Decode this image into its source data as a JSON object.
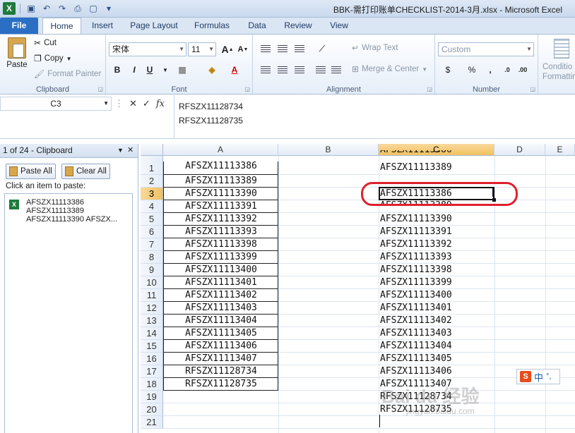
{
  "window": {
    "title": "BBK-需打印账单CHECKLIST-2014-3月.xlsx - Microsoft Excel"
  },
  "tabs": [
    "File",
    "Home",
    "Insert",
    "Page Layout",
    "Formulas",
    "Data",
    "Review",
    "View"
  ],
  "active_tab": "Home",
  "ribbon": {
    "clipboard": {
      "label": "Clipboard",
      "paste": "Paste",
      "cut": "Cut",
      "copy": "Copy",
      "format_painter": "Format Painter"
    },
    "font": {
      "label": "Font",
      "font_name": "宋体",
      "font_size": "11",
      "bold": "B",
      "italic": "I",
      "underline": "U",
      "grow": "A",
      "shrink": "A"
    },
    "alignment": {
      "label": "Alignment",
      "wrap_text": "Wrap Text",
      "merge_center": "Merge & Center"
    },
    "number": {
      "label": "Number",
      "format": "Custom",
      "currency": "$",
      "percent": "%",
      "comma": ","
    },
    "styles": {
      "conditional": "Conditio",
      "formatting": "Formattin"
    }
  },
  "formula_bar": {
    "name_box": "C3",
    "cancel": "✕",
    "enter": "✓",
    "fx": "fx",
    "content_lines": [
      "RFSZX11128734",
      "RFSZX11128735"
    ]
  },
  "clipboard_pane": {
    "title": "1 of 24 - Clipboard",
    "paste_all": "Paste All",
    "clear_all": "Clear All",
    "hint": "Click an item to paste:",
    "item_lines": [
      "AFSZX11113386",
      "AFSZX11113389",
      "AFSZX11113390 AFSZX..."
    ]
  },
  "sheet": {
    "columns": [
      "A",
      "B",
      "C",
      "D",
      "E"
    ],
    "selected_column": "C",
    "rows": [
      "1",
      "2",
      "3",
      "4",
      "5",
      "6",
      "7",
      "8",
      "9",
      "10",
      "11",
      "12",
      "13",
      "14",
      "15",
      "16",
      "17",
      "18",
      "19",
      "20",
      "21"
    ],
    "selected_row": "3",
    "column_a": [
      "AFSZX11113386",
      "AFSZX11113389",
      "AFSZX11113390",
      "AFSZX11113391",
      "AFSZX11113392",
      "AFSZX11113393",
      "AFSZX11113398",
      "AFSZX11113399",
      "AFSZX11113400",
      "AFSZX11113401",
      "AFSZX11113402",
      "AFSZX11113403",
      "AFSZX11113404",
      "AFSZX11113405",
      "AFSZX11113406",
      "AFSZX11113407",
      "RFSZX11128734",
      "RFSZX11128735"
    ],
    "column_c_top_partial": "AFSZX11113386",
    "column_c_row1": "AFSZX11113389",
    "column_c_active": "AFSZX11113386",
    "column_c_row4_partial": "AFSZX11113389",
    "column_c": [
      "AFSZX11113390",
      "AFSZX11113391",
      "AFSZX11113392",
      "AFSZX11113393",
      "AFSZX11113398",
      "AFSZX11113399",
      "AFSZX11113400",
      "AFSZX11113401",
      "AFSZX11113402",
      "AFSZX11113403",
      "AFSZX11113404",
      "AFSZX11113405",
      "AFSZX11113406",
      "AFSZX11113407",
      "RFSZX11128734",
      "RFSZX11128735"
    ]
  },
  "ime": {
    "brand": "S",
    "mode": "中"
  },
  "watermark": {
    "main": "Bai du 经验",
    "sub": "jingyan.baidu.com"
  },
  "colors": {
    "file_tab": "#2a6fc4",
    "annotation": "#e0202c",
    "selected_header": "#f1c15f"
  }
}
